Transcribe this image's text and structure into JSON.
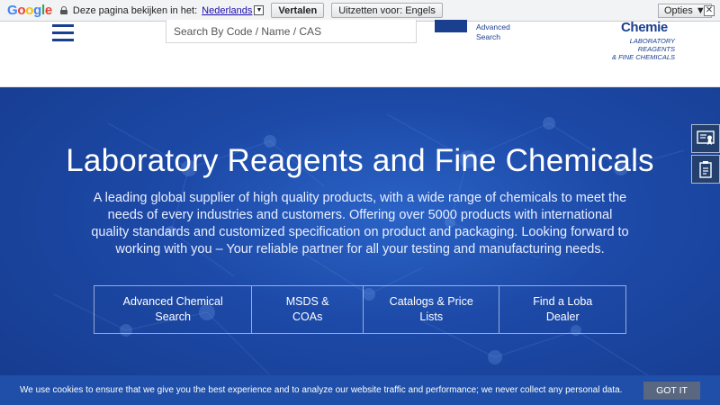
{
  "translate_bar": {
    "logo": [
      "G",
      "o",
      "o",
      "g",
      "l",
      "e"
    ],
    "prompt": "Deze pagina bekijken in het:",
    "language": "Nederlands",
    "translate_button": "Vertalen",
    "off_button": "Uitzetten voor: Engels",
    "options_button": "Opties ▼",
    "close_glyph": "✕"
  },
  "header": {
    "search_placeholder": "Search By Code / Name / CAS",
    "advanced_search": [
      "Advanced",
      "Search"
    ],
    "logo_name": "Chemie",
    "logo_tagline": [
      "LABORATORY REAGENTS",
      "& FINE CHEMICALS"
    ]
  },
  "hero": {
    "title": "Laboratory Reagents and Fine Chemicals",
    "description": "A leading global supplier of high quality products, with a wide range of chemicals to meet the needs of every industries and customers. Offering over 5000 products with international quality standards and customized specification on product and packaging. Looking forward to working with you – Your reliable partner for all your testing and manufacturing needs.",
    "links": [
      {
        "line1": "Advanced Chemical",
        "line2": "Search"
      },
      {
        "line1": "MSDS &",
        "line2": "COAs"
      },
      {
        "line1": "Catalogs & Price",
        "line2": "Lists"
      },
      {
        "line1": "Find a Loba",
        "line2": "Dealer"
      }
    ]
  },
  "side_widgets": [
    "certificate-icon",
    "document-icon"
  ],
  "cookie": {
    "text": "We use cookies to ensure that we give you the best experience and to analyze our website traffic and performance; we never collect any personal data.",
    "button": "GOT IT"
  },
  "colors": {
    "brand": "#1b3f8f",
    "hero": "#1d4aa8",
    "cookie_bar": "#1f4fa8",
    "cookie_button": "#5a6780"
  }
}
